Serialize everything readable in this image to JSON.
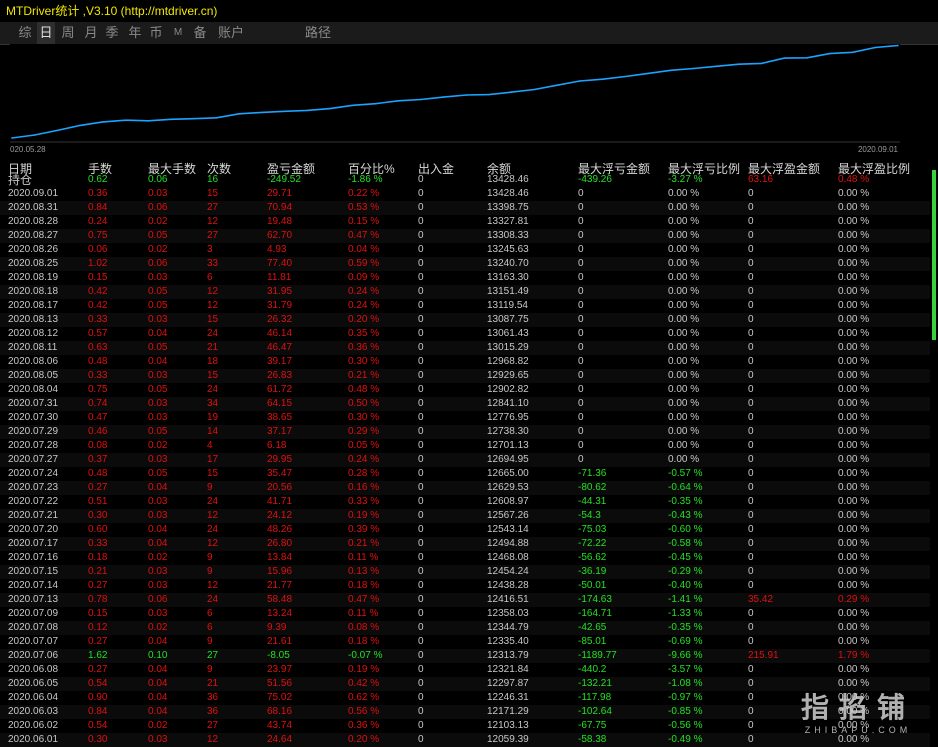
{
  "window": {
    "title": "MTDriver统计 ,V3.10 (http://mtdriver.cn)"
  },
  "tabs": [
    {
      "label": "综",
      "active": false
    },
    {
      "label": "日",
      "active": true
    },
    {
      "label": "周",
      "active": false
    },
    {
      "label": "月",
      "active": false
    },
    {
      "label": "季",
      "active": false
    },
    {
      "label": "年",
      "active": false
    },
    {
      "label": "币",
      "active": false
    },
    {
      "label": "M",
      "active": false
    },
    {
      "label": "备",
      "active": false
    },
    {
      "label": "账户",
      "active": false
    },
    {
      "label": "路径",
      "active": false
    }
  ],
  "chart_data": {
    "type": "line",
    "x_start_label": "020.05.28",
    "x_end_label": "2020.09.01",
    "ylim": [
      12000,
      13450
    ],
    "line_color": "#1aa3ff",
    "series": [
      {
        "values": [
          12059.39,
          12103.13,
          12171.29,
          12246.31,
          12297.87,
          12321.84,
          12313.79,
          12335.4,
          12344.79,
          12358.03,
          12416.51,
          12438.28,
          12454.24,
          12468.08,
          12494.88,
          12543.14,
          12567.26,
          12608.97,
          12629.53,
          12665.0,
          12694.95,
          12701.13,
          12738.3,
          12776.95,
          12841.1,
          12902.82,
          12929.65,
          12968.82,
          13015.29,
          13061.43,
          13087.75,
          13119.54,
          13151.49,
          13163.3,
          13240.7,
          13245.63,
          13308.33,
          13327.81,
          13398.75,
          13428.46
        ]
      }
    ]
  },
  "table": {
    "columns": [
      "日期",
      "手数",
      "最大手数",
      "次数",
      "盈亏金额",
      "百分比%",
      "出入金",
      "余额",
      "最大浮亏金额",
      "最大浮亏比例",
      "最大浮盈金额",
      "最大浮盈比例"
    ],
    "summary": {
      "date": "持仓",
      "lots": "0.62",
      "max_lots": "0.06",
      "count": "16",
      "pnl": "-249.52",
      "pct": "-1.86 %",
      "deposit": "0",
      "balance": "13428.46",
      "float_loss": "-439.26",
      "float_loss_pct": "-3.27 %",
      "float_profit": "63.16",
      "float_profit_pct": "0.48 %",
      "color": "green",
      "fp_color": "red"
    },
    "rows": [
      [
        "2020.09.01",
        "0.36",
        "0.03",
        "15",
        "29.71",
        "0.22 %",
        "0",
        "13428.46",
        "0",
        "0.00 %",
        "0",
        "0.00 %"
      ],
      [
        "2020.08.31",
        "0.84",
        "0.06",
        "27",
        "70.94",
        "0.53 %",
        "0",
        "13398.75",
        "0",
        "0.00 %",
        "0",
        "0.00 %"
      ],
      [
        "2020.08.28",
        "0.24",
        "0.02",
        "12",
        "19.48",
        "0.15 %",
        "0",
        "13327.81",
        "0",
        "0.00 %",
        "0",
        "0.00 %"
      ],
      [
        "2020.08.27",
        "0.75",
        "0.05",
        "27",
        "62.70",
        "0.47 %",
        "0",
        "13308.33",
        "0",
        "0.00 %",
        "0",
        "0.00 %"
      ],
      [
        "2020.08.26",
        "0.06",
        "0.02",
        "3",
        "4.93",
        "0.04 %",
        "0",
        "13245.63",
        "0",
        "0.00 %",
        "0",
        "0.00 %"
      ],
      [
        "2020.08.25",
        "1.02",
        "0.06",
        "33",
        "77.40",
        "0.59 %",
        "0",
        "13240.70",
        "0",
        "0.00 %",
        "0",
        "0.00 %"
      ],
      [
        "2020.08.19",
        "0.15",
        "0.03",
        "6",
        "11.81",
        "0.09 %",
        "0",
        "13163.30",
        "0",
        "0.00 %",
        "0",
        "0.00 %"
      ],
      [
        "2020.08.18",
        "0.42",
        "0.05",
        "12",
        "31.95",
        "0.24 %",
        "0",
        "13151.49",
        "0",
        "0.00 %",
        "0",
        "0.00 %"
      ],
      [
        "2020.08.17",
        "0.42",
        "0.05",
        "12",
        "31.79",
        "0.24 %",
        "0",
        "13119.54",
        "0",
        "0.00 %",
        "0",
        "0.00 %"
      ],
      [
        "2020.08.13",
        "0.33",
        "0.03",
        "15",
        "26.32",
        "0.20 %",
        "0",
        "13087.75",
        "0",
        "0.00 %",
        "0",
        "0.00 %"
      ],
      [
        "2020.08.12",
        "0.57",
        "0.04",
        "24",
        "46.14",
        "0.35 %",
        "0",
        "13061.43",
        "0",
        "0.00 %",
        "0",
        "0.00 %"
      ],
      [
        "2020.08.11",
        "0.63",
        "0.05",
        "21",
        "46.47",
        "0.36 %",
        "0",
        "13015.29",
        "0",
        "0.00 %",
        "0",
        "0.00 %"
      ],
      [
        "2020.08.06",
        "0.48",
        "0.04",
        "18",
        "39.17",
        "0.30 %",
        "0",
        "12968.82",
        "0",
        "0.00 %",
        "0",
        "0.00 %"
      ],
      [
        "2020.08.05",
        "0.33",
        "0.03",
        "15",
        "26.83",
        "0.21 %",
        "0",
        "12929.65",
        "0",
        "0.00 %",
        "0",
        "0.00 %"
      ],
      [
        "2020.08.04",
        "0.75",
        "0.05",
        "24",
        "61.72",
        "0.48 %",
        "0",
        "12902.82",
        "0",
        "0.00 %",
        "0",
        "0.00 %"
      ],
      [
        "2020.07.31",
        "0.74",
        "0.03",
        "34",
        "64.15",
        "0.50 %",
        "0",
        "12841.10",
        "0",
        "0.00 %",
        "0",
        "0.00 %"
      ],
      [
        "2020.07.30",
        "0.47",
        "0.03",
        "19",
        "38.65",
        "0.30 %",
        "0",
        "12776.95",
        "0",
        "0.00 %",
        "0",
        "0.00 %"
      ],
      [
        "2020.07.29",
        "0.46",
        "0.05",
        "14",
        "37.17",
        "0.29 %",
        "0",
        "12738.30",
        "0",
        "0.00 %",
        "0",
        "0.00 %"
      ],
      [
        "2020.07.28",
        "0.08",
        "0.02",
        "4",
        "6.18",
        "0.05 %",
        "0",
        "12701.13",
        "0",
        "0.00 %",
        "0",
        "0.00 %"
      ],
      [
        "2020.07.27",
        "0.37",
        "0.03",
        "17",
        "29.95",
        "0.24 %",
        "0",
        "12694.95",
        "0",
        "0.00 %",
        "0",
        "0.00 %"
      ],
      [
        "2020.07.24",
        "0.48",
        "0.05",
        "15",
        "35.47",
        "0.28 %",
        "0",
        "12665.00",
        "-71.36",
        "-0.57 %",
        "0",
        "0.00 %"
      ],
      [
        "2020.07.23",
        "0.27",
        "0.04",
        "9",
        "20.56",
        "0.16 %",
        "0",
        "12629.53",
        "-80.62",
        "-0.64 %",
        "0",
        "0.00 %"
      ],
      [
        "2020.07.22",
        "0.51",
        "0.03",
        "24",
        "41.71",
        "0.33 %",
        "0",
        "12608.97",
        "-44.31",
        "-0.35 %",
        "0",
        "0.00 %"
      ],
      [
        "2020.07.21",
        "0.30",
        "0.03",
        "12",
        "24.12",
        "0.19 %",
        "0",
        "12567.26",
        "-54.3",
        "-0.43 %",
        "0",
        "0.00 %"
      ],
      [
        "2020.07.20",
        "0.60",
        "0.04",
        "24",
        "48.26",
        "0.39 %",
        "0",
        "12543.14",
        "-75.03",
        "-0.60 %",
        "0",
        "0.00 %"
      ],
      [
        "2020.07.17",
        "0.33",
        "0.04",
        "12",
        "26.80",
        "0.21 %",
        "0",
        "12494.88",
        "-72.22",
        "-0.58 %",
        "0",
        "0.00 %"
      ],
      [
        "2020.07.16",
        "0.18",
        "0.02",
        "9",
        "13.84",
        "0.11 %",
        "0",
        "12468.08",
        "-56.62",
        "-0.45 %",
        "0",
        "0.00 %"
      ],
      [
        "2020.07.15",
        "0.21",
        "0.03",
        "9",
        "15.96",
        "0.13 %",
        "0",
        "12454.24",
        "-36.19",
        "-0.29 %",
        "0",
        "0.00 %"
      ],
      [
        "2020.07.14",
        "0.27",
        "0.03",
        "12",
        "21.77",
        "0.18 %",
        "0",
        "12438.28",
        "-50.01",
        "-0.40 %",
        "0",
        "0.00 %"
      ],
      [
        "2020.07.13",
        "0.78",
        "0.06",
        "24",
        "58.48",
        "0.47 %",
        "0",
        "12416.51",
        "-174.63",
        "-1.41 %",
        "35.42",
        "0.29 %"
      ],
      [
        "2020.07.09",
        "0.15",
        "0.03",
        "6",
        "13.24",
        "0.11 %",
        "0",
        "12358.03",
        "-164.71",
        "-1.33 %",
        "0",
        "0.00 %"
      ],
      [
        "2020.07.08",
        "0.12",
        "0.02",
        "6",
        "9.39",
        "0.08 %",
        "0",
        "12344.79",
        "-42.65",
        "-0.35 %",
        "0",
        "0.00 %"
      ],
      [
        "2020.07.07",
        "0.27",
        "0.04",
        "9",
        "21.61",
        "0.18 %",
        "0",
        "12335.40",
        "-85.01",
        "-0.69 %",
        "0",
        "0.00 %"
      ],
      [
        "2020.07.06",
        "1.62",
        "0.10",
        "27",
        "-8.05",
        "-0.07 %",
        "0",
        "12313.79",
        "-1189.77",
        "-9.66 %",
        "215.91",
        "1.79 %"
      ],
      [
        "2020.06.08",
        "0.27",
        "0.04",
        "9",
        "23.97",
        "0.19 %",
        "0",
        "12321.84",
        "-440.2",
        "-3.57 %",
        "0",
        "0.00 %"
      ],
      [
        "2020.06.05",
        "0.54",
        "0.04",
        "21",
        "51.56",
        "0.42 %",
        "0",
        "12297.87",
        "-132.21",
        "-1.08 %",
        "0",
        "0.00 %"
      ],
      [
        "2020.06.04",
        "0.90",
        "0.04",
        "36",
        "75.02",
        "0.62 %",
        "0",
        "12246.31",
        "-117.98",
        "-0.97 %",
        "0",
        "0.00 %"
      ],
      [
        "2020.06.03",
        "0.84",
        "0.04",
        "36",
        "68.16",
        "0.56 %",
        "0",
        "12171.29",
        "-102.64",
        "-0.85 %",
        "0",
        "0.00 %"
      ],
      [
        "2020.06.02",
        "0.54",
        "0.02",
        "27",
        "43.74",
        "0.36 %",
        "0",
        "12103.13",
        "-67.75",
        "-0.56 %",
        "0",
        "0.00 %"
      ],
      [
        "2020.06.01",
        "0.30",
        "0.03",
        "12",
        "24.64",
        "0.20 %",
        "0",
        "12059.39",
        "-58.38",
        "-0.49 %",
        "0",
        "0.00 %"
      ]
    ]
  },
  "watermark": {
    "big": "指掐铺",
    "small": "ZHIBAPU.COM"
  }
}
